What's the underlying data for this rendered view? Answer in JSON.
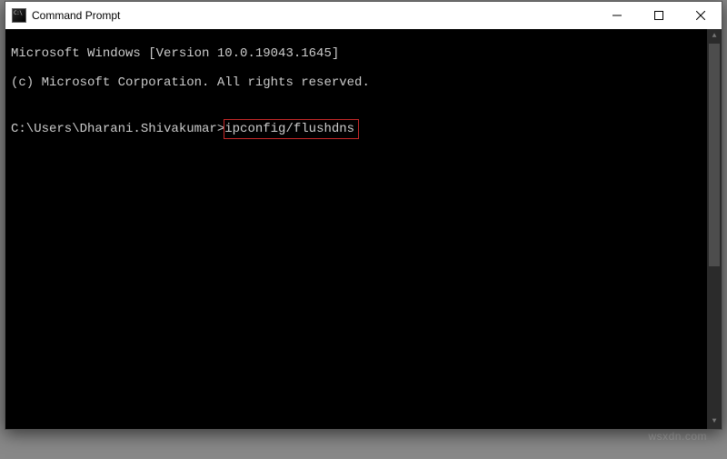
{
  "titlebar": {
    "title": "Command Prompt"
  },
  "terminal": {
    "line1": "Microsoft Windows [Version 10.0.19043.1645]",
    "line2": "(c) Microsoft Corporation. All rights reserved.",
    "blank": "",
    "prompt": "C:\\Users\\Dharani.Shivakumar>",
    "command": "ipconfig/flushdns"
  },
  "watermark": "wsxdn.com"
}
